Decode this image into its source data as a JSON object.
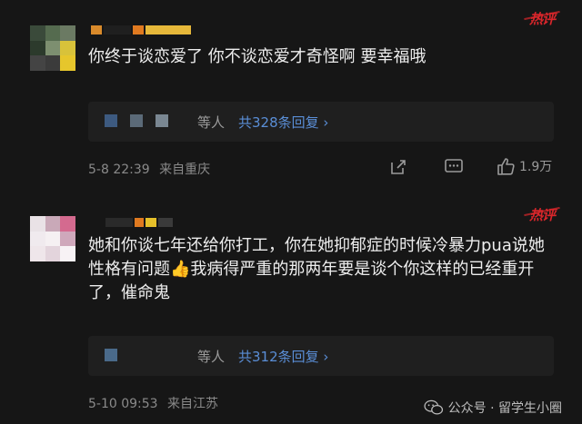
{
  "comments": [
    {
      "hot_badge": "热评",
      "text": "你终于谈恋爱了 你不谈恋爱才奇怪啊 要幸福哦",
      "replies_prefix": "等人",
      "replies_link": "共328条回复",
      "date": "5-8 22:39",
      "location": "来自重庆",
      "likes": "1.9万"
    },
    {
      "hot_badge": "热评",
      "text_part1": "她和你谈七年还给你打工，你在她抑郁症的时候冷暴力pua说她性格有问题",
      "emoji": "👍",
      "text_part2": "我病得严重的那两年要是谈个你这样的已经重开了，催命鬼",
      "replies_prefix": "等人",
      "replies_link": "共312条回复",
      "date": "5-10 09:53",
      "location": "来自江苏"
    }
  ],
  "watermark": {
    "text": "公众号 · 留学生小圈"
  },
  "colors": {
    "background": "#161616",
    "link": "#5a8ed6",
    "hot": "#d9262b"
  }
}
